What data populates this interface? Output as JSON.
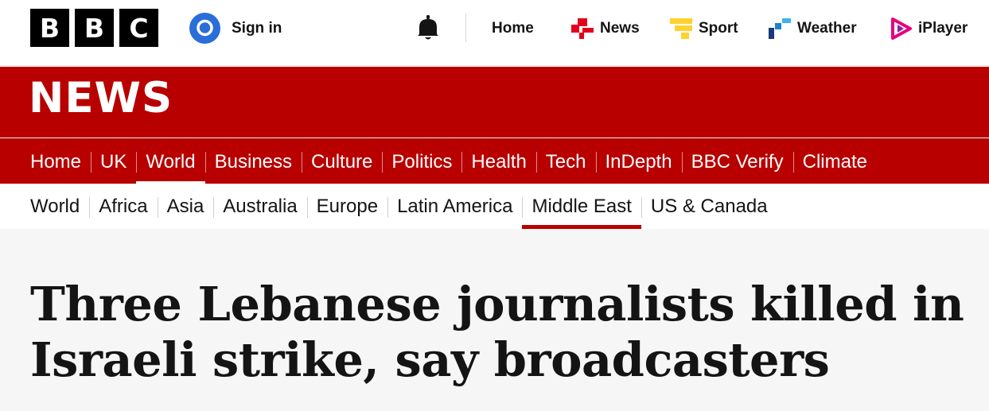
{
  "brand": {
    "logo_letters": [
      "B",
      "B",
      "C"
    ]
  },
  "account": {
    "signin_label": "Sign in",
    "icon": "user-icon"
  },
  "notifications": {
    "icon": "bell-icon"
  },
  "global_nav": [
    {
      "label": "Home",
      "icon": ""
    },
    {
      "label": "News",
      "icon": "news-icon",
      "color": "#e3001b"
    },
    {
      "label": "Sport",
      "icon": "sport-icon",
      "color": "#ffd230"
    },
    {
      "label": "Weather",
      "icon": "weather-icon",
      "color": "#1a85c8"
    },
    {
      "label": "iPlayer",
      "icon": "iplayer-icon",
      "color": "#e6007e"
    }
  ],
  "masthead": {
    "title": "NEWS",
    "color": "#b80000"
  },
  "primary_nav": {
    "active": "World",
    "items": [
      "Home",
      "UK",
      "World",
      "Business",
      "Culture",
      "Politics",
      "Health",
      "Tech",
      "InDepth",
      "BBC Verify",
      "Climate"
    ]
  },
  "secondary_nav": {
    "active": "Middle East",
    "items": [
      "World",
      "Africa",
      "Asia",
      "Australia",
      "Europe",
      "Latin America",
      "Middle East",
      "US & Canada"
    ]
  },
  "article": {
    "headline": "Three Lebanese journalists killed in Israeli strike, say broadcasters"
  }
}
